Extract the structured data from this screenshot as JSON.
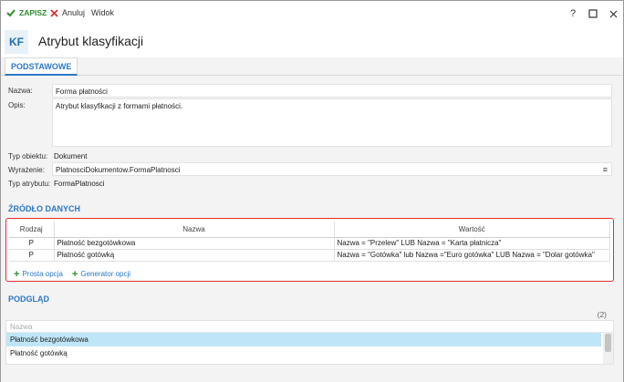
{
  "toolbar": {
    "save_label": "ZAPISZ",
    "cancel_label": "Anuluj",
    "view_label": "Widok",
    "help_label": "?"
  },
  "header": {
    "badge": "KF",
    "title": "Atrybut klasyfikacji"
  },
  "tabs": [
    {
      "label": "PODSTAWOWE"
    }
  ],
  "form": {
    "name_label": "Nazwa:",
    "name_value": "Forma płatności",
    "desc_label": "Opis:",
    "desc_value": "Atrybut klasyfikacji z formami płatności.",
    "object_type_label": "Typ obiektu:",
    "object_type_value": "Dokument",
    "expression_label": "Wyrażenie:",
    "expression_value": "PlatnosciDokumentow.FormaPlatnosci",
    "attr_type_label": "Typ atrybutu:",
    "attr_type_value": "FormaPlatnosci"
  },
  "data_source": {
    "title": "ŹRÓDŁO DANYCH",
    "columns": [
      "Rodzaj",
      "Nazwa",
      "Wartość"
    ],
    "rows": [
      {
        "kind": "P",
        "name": "Płatność bezgotówkowa",
        "value": "Nazwa = \"Przelew\" LUB Nazwa = \"Karta płatnicza\""
      },
      {
        "kind": "P",
        "name": "Płatność gotówką",
        "value": "Nazwa = \"Gotówka\" lub Nazwa =\"Euro gotówka\" LUB Nazwa = \"Dolar gotówka\""
      }
    ],
    "add_simple_label": "Prosta opcja",
    "add_generator_label": "Generator opcji"
  },
  "preview": {
    "title": "PODGLĄD",
    "count": "(2)",
    "column_header": "Nazwa",
    "items": [
      "Płatność bezgotówkowa",
      "Płatność gotówką"
    ]
  },
  "colors": {
    "accent": "#2b79c2",
    "save_green": "#2e8b2e",
    "cancel_red": "#d93030",
    "highlight_border": "#e03030",
    "selected_row": "#bfe6f8"
  }
}
